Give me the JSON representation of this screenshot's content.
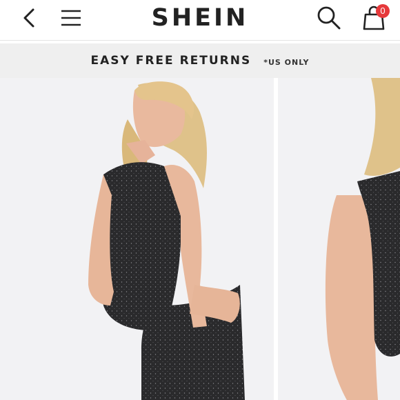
{
  "header": {
    "logo": "SHEIN",
    "icons": {
      "back": "chevron-left-icon",
      "menu": "hamburger-menu-icon",
      "search": "search-icon",
      "bag": "shopping-bag-icon"
    },
    "bag_count": "0",
    "badge_color": "#e6393b"
  },
  "promo": {
    "main_text": "EASY FREE RETURNS",
    "note_text": "*US ONLY"
  },
  "gallery": {
    "images": [
      "product-photo-back-view",
      "product-photo-side-view"
    ]
  }
}
